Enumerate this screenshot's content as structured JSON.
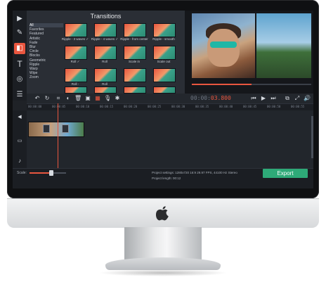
{
  "app": {
    "panel_title": "Transitions",
    "categories": [
      "All",
      "Favorites",
      "Featured",
      "Artistic",
      "Fade",
      "Blur",
      "Circle",
      "Blocks",
      "Geometric",
      "Ripple",
      "Warp",
      "Wipe",
      "Zoom"
    ],
    "selected_category": "All",
    "transition_thumbs": [
      {
        "label": "Ripple - 3 waves ✓"
      },
      {
        "label": "Ripple - 4 waves ✓"
      },
      {
        "label": "Ripple - from center"
      },
      {
        "label": "Ripple - smooth"
      },
      {
        "label": "Roll ✓"
      },
      {
        "label": "Roll"
      },
      {
        "label": "Scale in"
      },
      {
        "label": "Scale out"
      },
      {
        "label": "Roll -"
      },
      {
        "label": "Roll"
      },
      {
        "label": ""
      },
      {
        "label": ""
      }
    ]
  },
  "player": {
    "timecode_grey": "00:00:",
    "timecode_red": "03.800"
  },
  "timeline": {
    "ruler_labels": [
      "00:00:00",
      "00:00:05",
      "00:00:10",
      "00:00:15",
      "00:00:20",
      "00:00:25",
      "00:00:30",
      "00:00:35",
      "00:00:40",
      "00:00:45",
      "00:00:50",
      "00:00:55"
    ]
  },
  "bottom": {
    "scale_label": "Scale:",
    "project_settings": "Project settings:  1280x720 16:9 29.97 FPS, 44100 Hz Stereo",
    "project_length": "Project length:      00:12",
    "export_label": "Export"
  },
  "icons": [
    "film-icon",
    "wand-icon",
    "transitions-icon",
    "text-icon",
    "filters-icon",
    "list-icon",
    "undo-icon",
    "redo-icon",
    "crop-icon",
    "color-icon",
    "delete-icon",
    "clip-icon",
    "microphone-icon",
    "settings-icon",
    "skip-back-icon",
    "play-icon",
    "skip-forward-icon",
    "export-small-icon",
    "fullscreen-icon",
    "volume-icon",
    "speaker-icon",
    "camera-icon",
    "music-icon",
    "apple-logo-icon"
  ],
  "colors": {
    "accent": "#e9563f",
    "export": "#2eaa78",
    "panel": "#2a2e35"
  }
}
